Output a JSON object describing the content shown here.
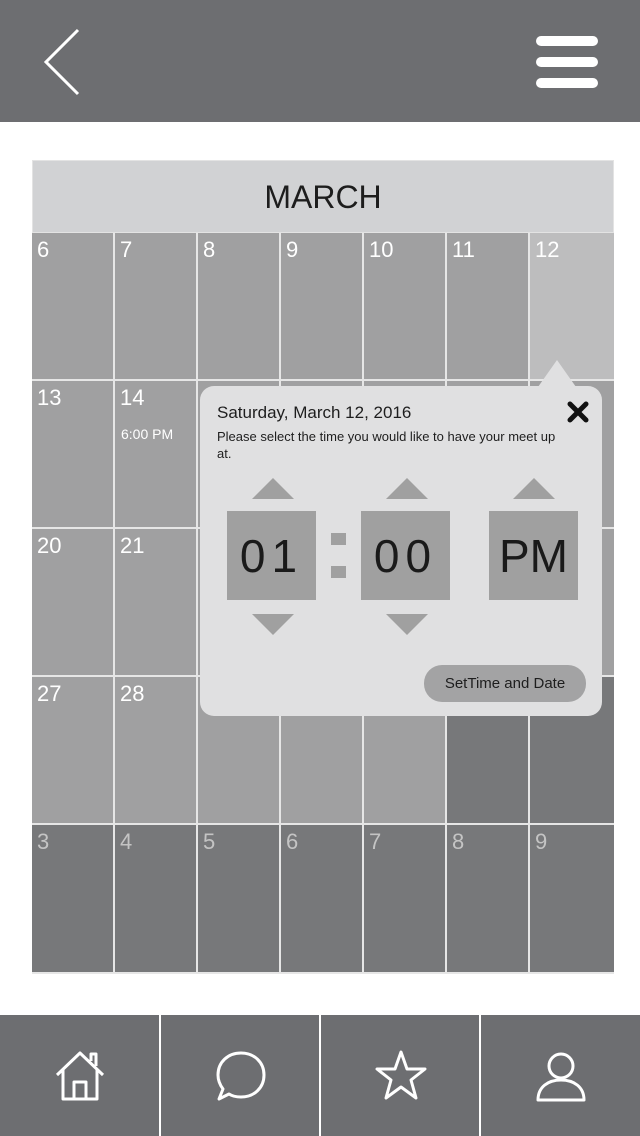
{
  "topbar": {
    "back_icon": "chevron-left-icon",
    "menu_icon": "hamburger-menu-icon"
  },
  "calendar": {
    "month": "MARCH",
    "weeks": [
      {
        "days": [
          {
            "num": "6",
            "event": "",
            "dim": false,
            "color": "#a0a0a1"
          },
          {
            "num": "7",
            "event": "",
            "dim": false,
            "color": "#a0a0a1"
          },
          {
            "num": "8",
            "event": "",
            "dim": false,
            "color": "#a0a0a1"
          },
          {
            "num": "9",
            "event": "",
            "dim": false,
            "color": "#a0a0a1"
          },
          {
            "num": "10",
            "event": "",
            "dim": false,
            "color": "#a0a0a1"
          },
          {
            "num": "11",
            "event": "",
            "dim": false,
            "color": "#a0a0a1"
          },
          {
            "num": "12",
            "event": "",
            "dim": false,
            "color": "#bdbdbe"
          }
        ]
      },
      {
        "days": [
          {
            "num": "13",
            "event": "",
            "dim": false,
            "color": "#a0a0a1"
          },
          {
            "num": "14",
            "event": "6:00 PM",
            "dim": false,
            "color": "#a0a0a1"
          },
          {
            "num": "",
            "event": "",
            "dim": false,
            "color": "#a0a0a1"
          },
          {
            "num": "",
            "event": "",
            "dim": false,
            "color": "#a0a0a1"
          },
          {
            "num": "",
            "event": "",
            "dim": false,
            "color": "#a0a0a1"
          },
          {
            "num": "",
            "event": "",
            "dim": false,
            "color": "#a0a0a1"
          },
          {
            "num": "",
            "event": "",
            "dim": false,
            "color": "#a0a0a1"
          }
        ]
      },
      {
        "days": [
          {
            "num": "20",
            "event": "",
            "dim": false,
            "color": "#a0a0a1"
          },
          {
            "num": "21",
            "event": "",
            "dim": false,
            "color": "#a0a0a1"
          },
          {
            "num": "",
            "event": "",
            "dim": false,
            "color": "#a0a0a1"
          },
          {
            "num": "",
            "event": "",
            "dim": false,
            "color": "#a0a0a1"
          },
          {
            "num": "",
            "event": "",
            "dim": false,
            "color": "#a0a0a1"
          },
          {
            "num": "",
            "event": "",
            "dim": false,
            "color": "#a0a0a1"
          },
          {
            "num": "",
            "event": "",
            "dim": false,
            "color": "#a0a0a1"
          }
        ]
      },
      {
        "days": [
          {
            "num": "27",
            "event": "",
            "dim": false,
            "color": "#a0a0a1"
          },
          {
            "num": "28",
            "event": "",
            "dim": false,
            "color": "#a0a0a1"
          },
          {
            "num": "",
            "event": "",
            "dim": false,
            "color": "#a0a0a1"
          },
          {
            "num": "",
            "event": "",
            "dim": false,
            "color": "#a0a0a1"
          },
          {
            "num": "",
            "event": "",
            "dim": false,
            "color": "#a0a0a1"
          },
          {
            "num": "",
            "event": "",
            "dim": false,
            "color": "#77787a"
          },
          {
            "num": "",
            "event": "",
            "dim": false,
            "color": "#77787a"
          }
        ]
      },
      {
        "days": [
          {
            "num": "3",
            "event": "",
            "dim": true,
            "color": "#77787a"
          },
          {
            "num": "4",
            "event": "",
            "dim": true,
            "color": "#77787a"
          },
          {
            "num": "5",
            "event": "",
            "dim": true,
            "color": "#77787a"
          },
          {
            "num": "6",
            "event": "",
            "dim": true,
            "color": "#77787a"
          },
          {
            "num": "7",
            "event": "",
            "dim": true,
            "color": "#77787a"
          },
          {
            "num": "8",
            "event": "",
            "dim": true,
            "color": "#77787a"
          },
          {
            "num": "9",
            "event": "",
            "dim": true,
            "color": "#77787a"
          }
        ]
      }
    ]
  },
  "popup": {
    "date": "Saturday, March 12, 2016",
    "message": "Please select the time you would like to have your meet up at.",
    "hour": "01",
    "minute": "00",
    "period": "PM",
    "close_icon": "close-icon",
    "set_button": "SetTime and Date"
  },
  "bottombar": {
    "tabs": [
      {
        "name": "home",
        "icon": "home-icon"
      },
      {
        "name": "chat",
        "icon": "chat-bubble-icon"
      },
      {
        "name": "favorites",
        "icon": "star-icon"
      },
      {
        "name": "profile",
        "icon": "user-icon"
      }
    ]
  },
  "colors": {
    "bar": "#6d6e71",
    "popup": "#e0e0e1",
    "control": "#a0a0a0"
  }
}
